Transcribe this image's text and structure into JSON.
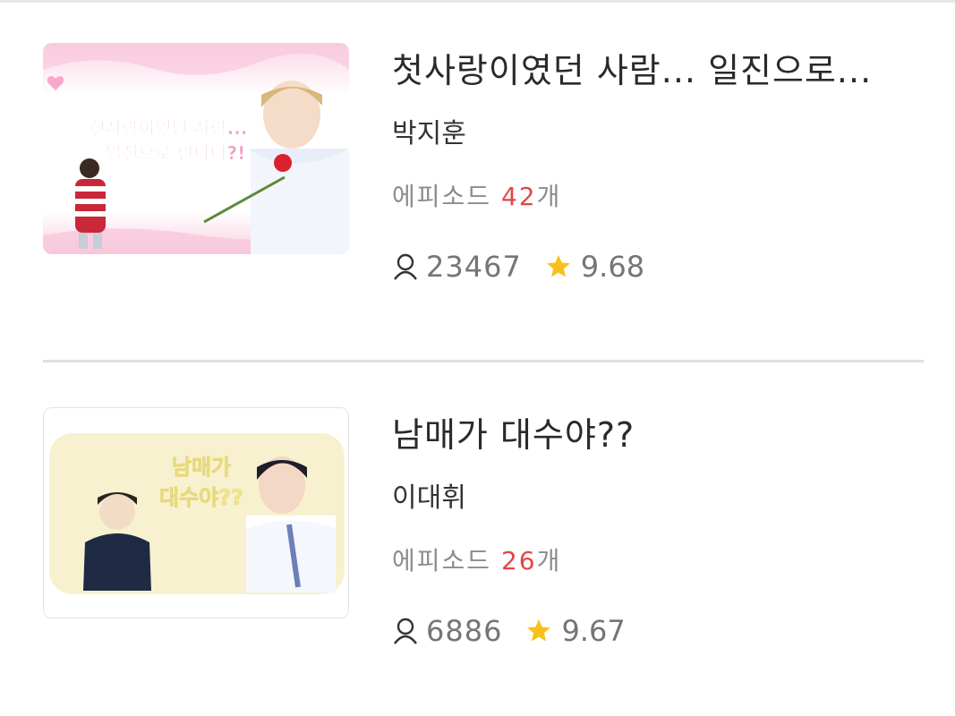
{
  "items": [
    {
      "title": "첫사랑이였던 사람... 일진으로...",
      "author": "박지훈",
      "episodes_label": "에피소드",
      "episodes_count": "42",
      "episodes_suffix": "개",
      "views": "23467",
      "rating": "9.68",
      "thumbnail": {
        "caption_line1": "첫사랑이였던 사람...",
        "caption_line2": "일진으로 만나다?!",
        "theme_color": "#f7c6d9"
      }
    },
    {
      "title": "남매가 대수야??",
      "author": "이대휘",
      "episodes_label": "에피소드",
      "episodes_count": "26",
      "episodes_suffix": "개",
      "views": "6886",
      "rating": "9.67",
      "thumbnail": {
        "caption_line1": "남매가",
        "caption_line2": "대수야??",
        "theme_color": "#f8f1cf"
      }
    }
  ],
  "icons": {
    "views": "person-icon",
    "rating": "star-icon"
  },
  "colors": {
    "accent_red": "#e64545",
    "star_yellow": "#f6c21a",
    "muted_text": "#8c8c8c"
  }
}
